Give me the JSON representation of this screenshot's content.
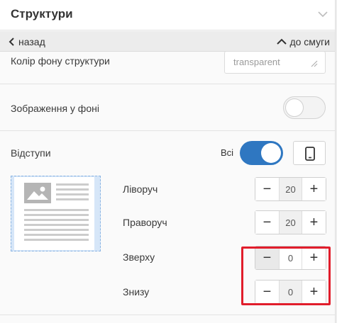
{
  "header": {
    "title": "Структури",
    "chevron_icon": "chevron-down-icon"
  },
  "nav": {
    "back_label": "назад",
    "top_label": "до смуги"
  },
  "bg_color": {
    "label": "Колір фону структури",
    "value": "transparent",
    "icon": "droplet-icon"
  },
  "bg_image": {
    "label": "Зображення у фоні",
    "enabled": false
  },
  "spacing": {
    "label": "Відступи",
    "all_label": "Всі",
    "all_enabled": true,
    "device_icon": "mobile-icon",
    "items": [
      {
        "label": "Ліворуч",
        "value": "20"
      },
      {
        "label": "Праворуч",
        "value": "20"
      },
      {
        "label": "Зверху",
        "value": "0"
      },
      {
        "label": "Знизу",
        "value": "0"
      }
    ]
  },
  "colors": {
    "accent": "#2f77c1",
    "highlight": "#e11d2b",
    "preview_bg": "#d6e6f8"
  }
}
